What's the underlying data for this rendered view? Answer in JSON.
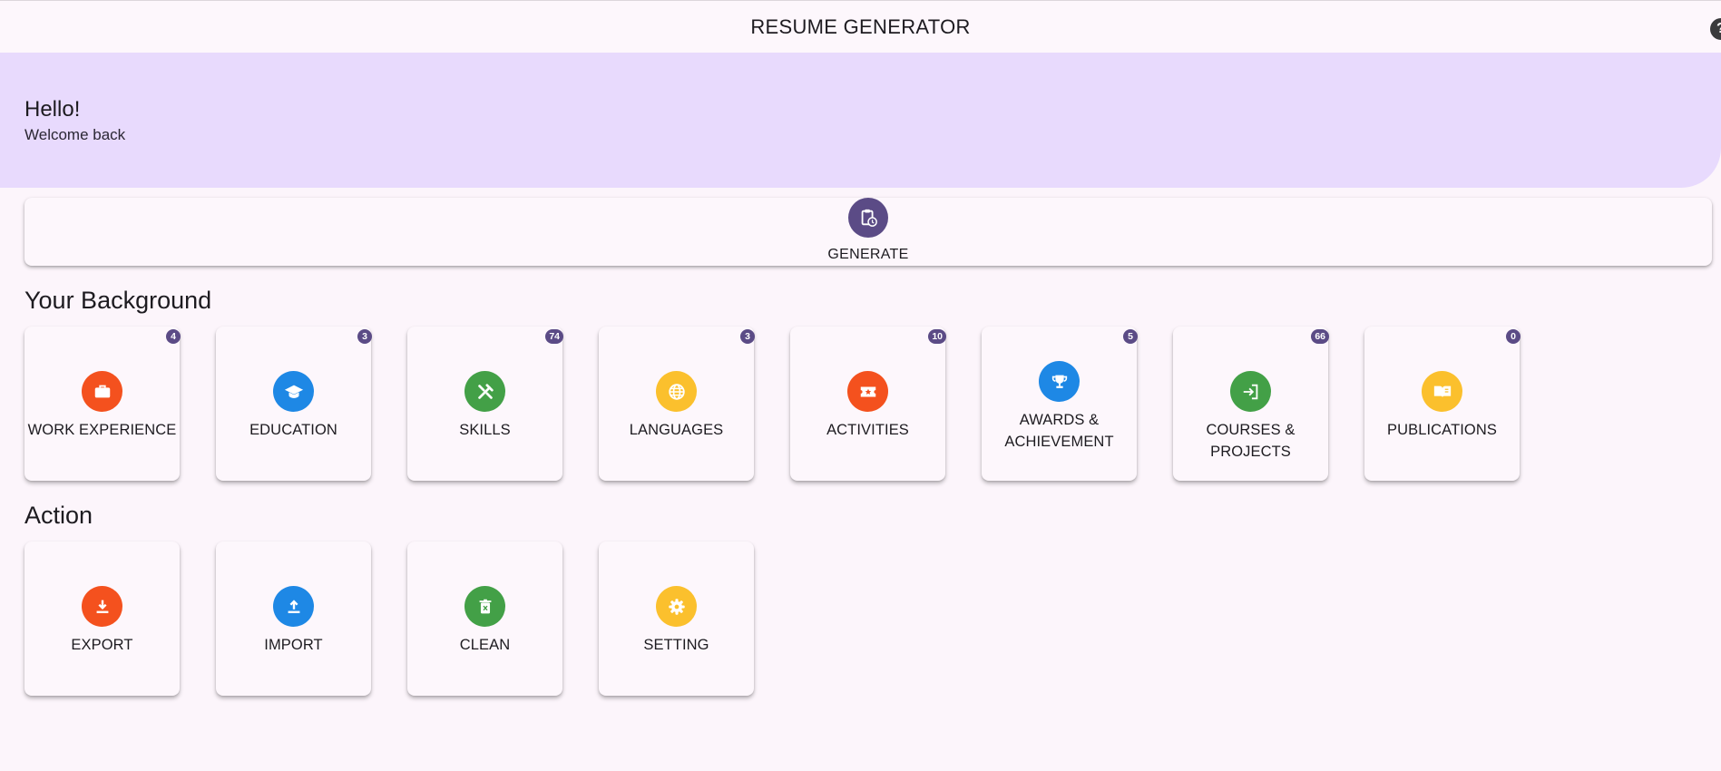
{
  "app": {
    "title": "RESUME GENERATOR",
    "help_glyph": "?"
  },
  "hero": {
    "title": "Hello!",
    "subtitle": "Welcome back",
    "color": "#e8dafd"
  },
  "generate": {
    "label": "GENERATE",
    "icon": "clipboard-clock-icon",
    "color": "#5b4b86"
  },
  "background": {
    "title": "Your Background",
    "items": [
      {
        "label": "WORK EXPERIENCE",
        "count": "4",
        "icon": "briefcase-icon",
        "color": "#f4511e"
      },
      {
        "label": "EDUCATION",
        "count": "3",
        "icon": "graduation-cap-icon",
        "color": "#1e88e5"
      },
      {
        "label": "SKILLS",
        "count": "74",
        "icon": "tools-icon",
        "color": "#43a047"
      },
      {
        "label": "LANGUAGES",
        "count": "3",
        "icon": "globe-icon",
        "color": "#fbc02d"
      },
      {
        "label": "ACTIVITIES",
        "count": "10",
        "icon": "ticket-star-icon",
        "color": "#f4511e"
      },
      {
        "label_line1": "AWARDS &",
        "label_line2": "ACHIEVEMENT",
        "count": "5",
        "icon": "trophy-icon",
        "color": "#1e88e5"
      },
      {
        "label": "COURSES & PROJECTS",
        "count": "66",
        "icon": "login-arrow-icon",
        "color": "#43a047"
      },
      {
        "label": "PUBLICATIONS",
        "count": "0",
        "icon": "open-book-icon",
        "color": "#fbc02d"
      }
    ]
  },
  "action": {
    "title": "Action",
    "items": [
      {
        "label": "EXPORT",
        "icon": "download-icon",
        "color": "#f4511e"
      },
      {
        "label": "IMPORT",
        "icon": "upload-icon",
        "color": "#1e88e5"
      },
      {
        "label": "CLEAN",
        "icon": "delete-icon",
        "color": "#43a047"
      },
      {
        "label": "SETTING",
        "icon": "gear-icon",
        "color": "#fbc02d"
      }
    ]
  }
}
